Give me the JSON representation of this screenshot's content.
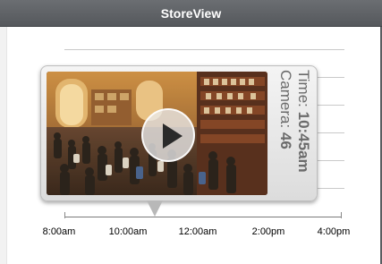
{
  "window": {
    "title": "StoreView"
  },
  "video": {
    "play_icon": "play-icon",
    "time_label": "Time:",
    "time_value": "10:45am",
    "camera_label": "Camera:",
    "camera_value": "46"
  },
  "timeline": {
    "ticks": [
      "8:00am",
      "10:00am",
      "12:00am",
      "2:00pm",
      "4:00pm"
    ]
  },
  "colors": {
    "titlebar": "#5f6266",
    "card": "#e6e6e6",
    "info_text": "#6a6a6a"
  }
}
